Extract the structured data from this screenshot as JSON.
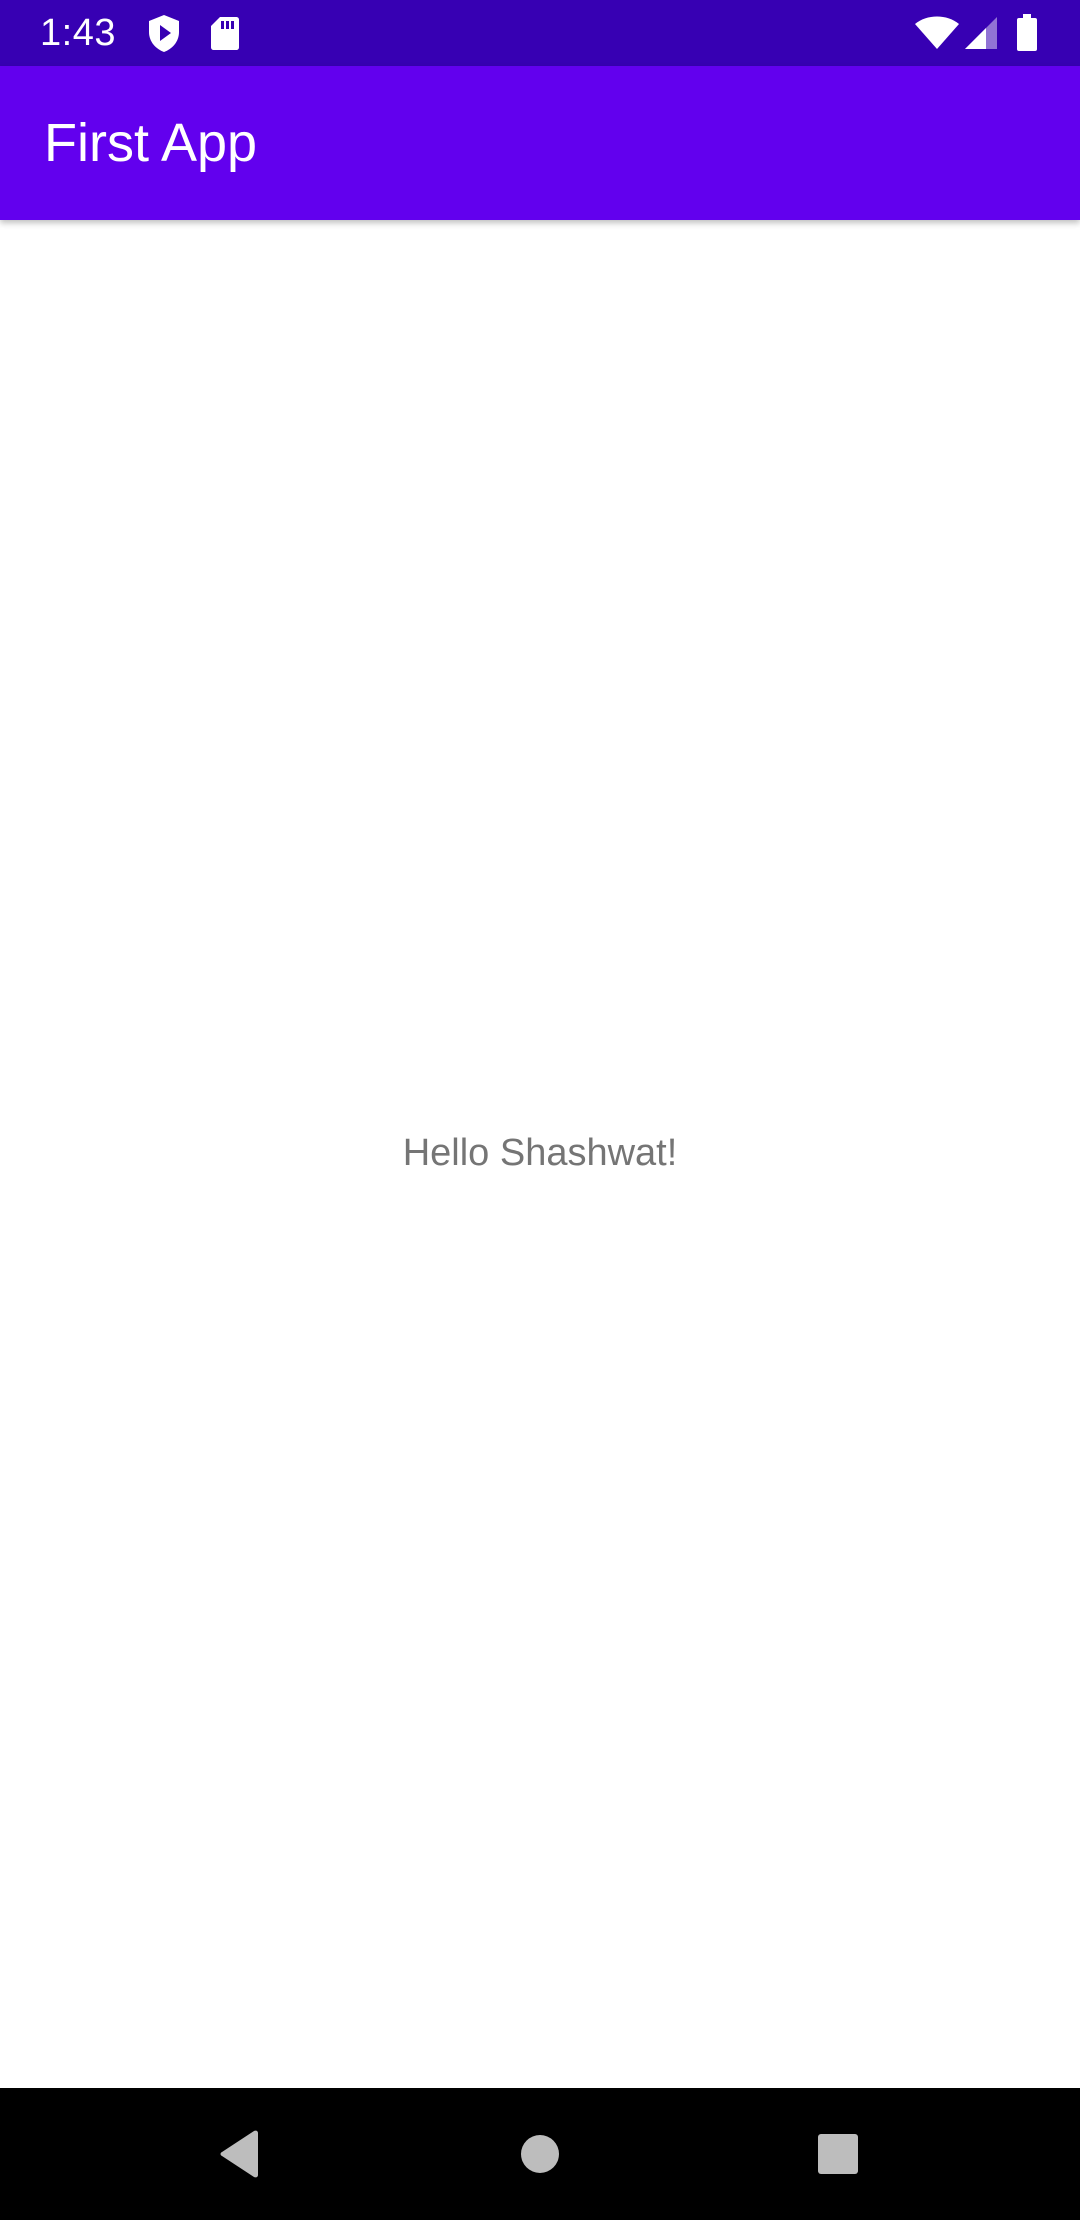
{
  "status_bar": {
    "time": "1:43",
    "background": "#3700b3",
    "icons": [
      "play-protect-icon",
      "sd-card-icon",
      "wifi-icon",
      "cell-signal-icon",
      "battery-icon"
    ]
  },
  "app_bar": {
    "title": "First App",
    "background": "#6200ee"
  },
  "content": {
    "greeting": "Hello Shashwat!"
  },
  "nav_bar": {
    "buttons": [
      "back-icon",
      "home-icon",
      "recents-icon"
    ]
  }
}
